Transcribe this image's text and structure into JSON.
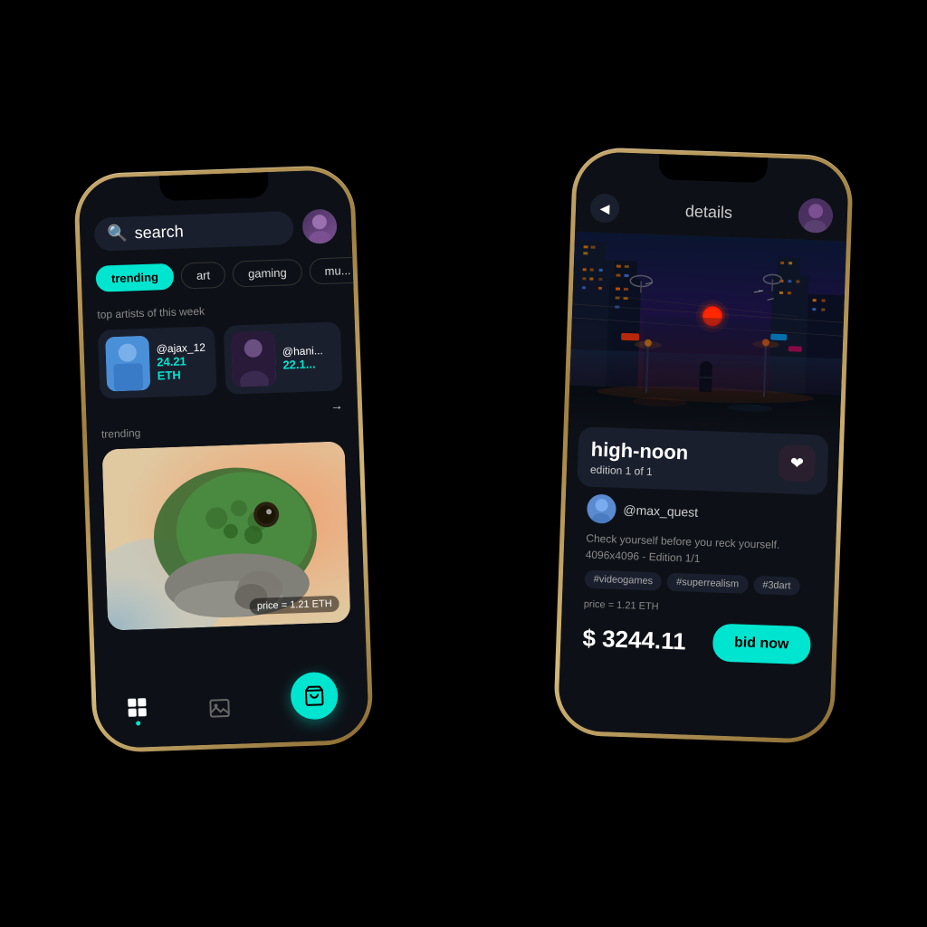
{
  "left_phone": {
    "search_placeholder": "search",
    "search_icon": "🔍",
    "filters": [
      "trending",
      "art",
      "gaming",
      "mu..."
    ],
    "active_filter": "trending",
    "arrow_label": "→",
    "top_artists_title": "top artists of this week",
    "artists": [
      {
        "name": "@ajax_12",
        "eth": "24.21 ETH"
      },
      {
        "name": "@hani...",
        "eth": "22.1..."
      }
    ],
    "trending_label": "trending",
    "price_tag": "price = 1.21 ETH",
    "nav_icons": [
      "grid",
      "image",
      "cart"
    ],
    "cart_icon": "🛒"
  },
  "right_phone": {
    "back_icon": "◀",
    "details_title": "details",
    "artwork_title": "high-noon",
    "artwork_edition": "edition 1 of 1",
    "heart_icon": "❤",
    "creator_name": "@max_quest",
    "description": "Check yourself before you reck yourself. 4096x4096 - Edition 1/1",
    "tags": [
      "#videogames",
      "#superrealism",
      "#3dart"
    ],
    "price_label": "price = 1.21 ETH",
    "price_usd": "$ 3244.11",
    "bid_button_label": "bid now"
  },
  "colors": {
    "accent": "#00e5d0",
    "background": "#0d1117",
    "card": "#1a1f2e"
  }
}
